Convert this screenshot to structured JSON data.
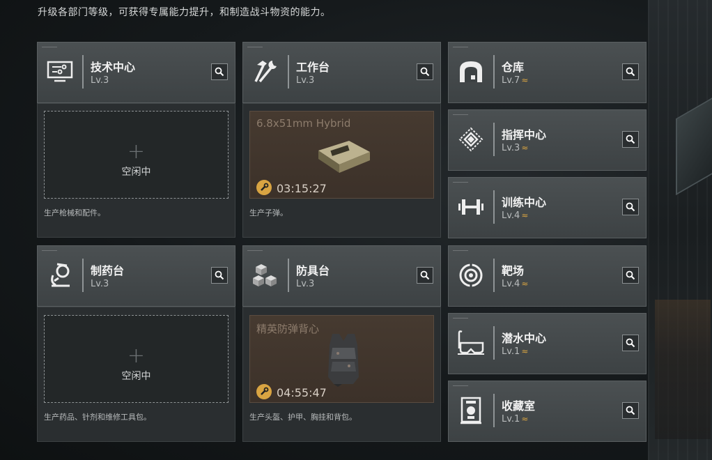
{
  "intro": "升级各部门等级，可获得专属能力提升，和制造战斗物资的能力。",
  "accent_color": "#d9a442",
  "departments_main": [
    {
      "id": "tech",
      "icon": "computer-icon",
      "name": "技术中心",
      "level": "Lv.3",
      "slot_state": "idle",
      "idle_label": "空闲中",
      "description": "生产枪械和配件。"
    },
    {
      "id": "workbench",
      "icon": "tools-icon",
      "name": "工作台",
      "level": "Lv.3",
      "slot_state": "busy",
      "item_name": "6.8x51mm Hybrid",
      "timer": "03:15:27",
      "description": "生产子弹。"
    },
    {
      "id": "pharmacy",
      "icon": "microscope-icon",
      "name": "制药台",
      "level": "Lv.3",
      "slot_state": "idle",
      "idle_label": "空闲中",
      "description": "生产药品、针剂和维修工具包。"
    },
    {
      "id": "armor",
      "icon": "cubes-icon",
      "name": "防具台",
      "level": "Lv.3",
      "slot_state": "busy",
      "item_name": "精英防弹背心",
      "timer": "04:55:47",
      "description": "生产头盔、护甲、胸挂和背包。"
    }
  ],
  "departments_side": [
    {
      "id": "warehouse",
      "icon": "warehouse-icon",
      "name": "仓库",
      "level": "Lv.7",
      "upgrade": "≈"
    },
    {
      "id": "command",
      "icon": "command-diamond-icon",
      "name": "指挥中心",
      "level": "Lv.3",
      "upgrade": "≈"
    },
    {
      "id": "training",
      "icon": "dumbbell-icon",
      "name": "训练中心",
      "level": "Lv.4",
      "upgrade": "≈"
    },
    {
      "id": "range",
      "icon": "target-icon",
      "name": "靶场",
      "level": "Lv.4",
      "upgrade": "≈"
    },
    {
      "id": "diving",
      "icon": "diving-mask-icon",
      "name": "潜水中心",
      "level": "Lv.1",
      "upgrade": "≈"
    },
    {
      "id": "collection",
      "icon": "display-case-icon",
      "name": "收藏室",
      "level": "Lv.1",
      "upgrade": "≈"
    }
  ]
}
